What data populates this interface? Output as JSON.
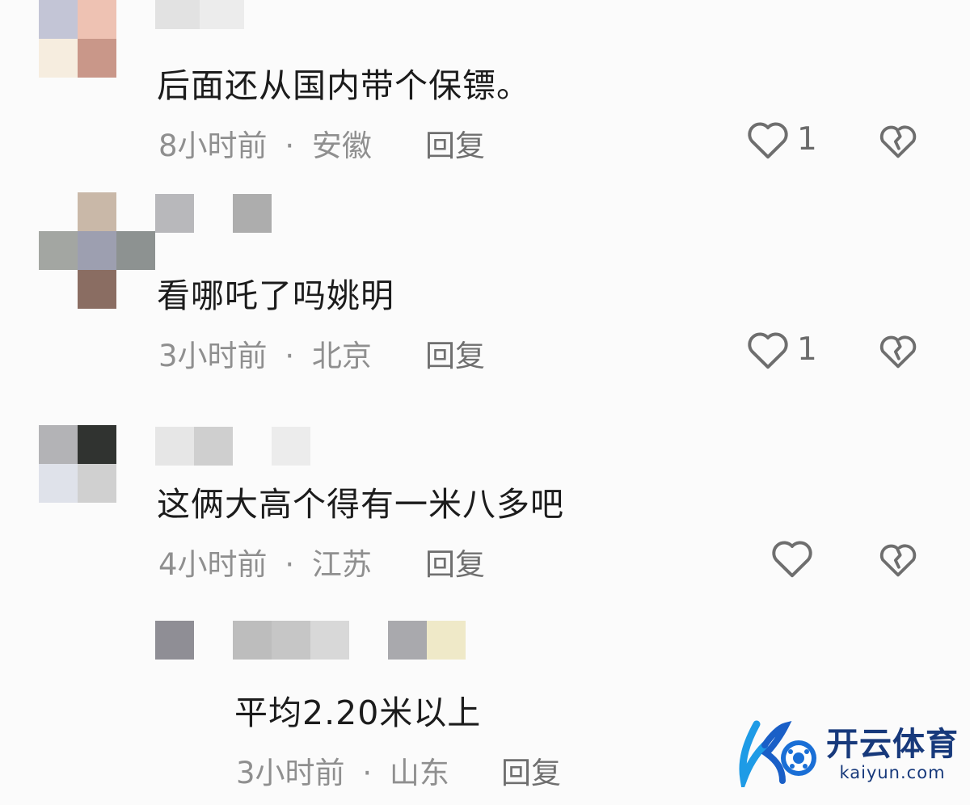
{
  "comments": [
    {
      "text": "后面还从国内带个保镖。",
      "time": "8小时前",
      "sep": "·",
      "location": "安徽",
      "reply_label": "回复",
      "likes": "1"
    },
    {
      "text": "看哪吒了吗姚明",
      "time": "3小时前",
      "sep": "·",
      "location": "北京",
      "reply_label": "回复",
      "likes": "1"
    },
    {
      "text": "这俩大高个得有一米八多吧",
      "time": "4小时前",
      "sep": "·",
      "location": "江苏",
      "reply_label": "回复",
      "likes": ""
    },
    {
      "text": "平均2.20米以上",
      "time": "3小时前",
      "sep": "·",
      "location": "山东",
      "reply_label": "回复"
    }
  ],
  "watermark": {
    "name": "开云体育",
    "domain": "kaiyun.com"
  },
  "icons": {
    "like": "heart-outline-icon",
    "dislike": "broken-heart-icon"
  },
  "colors": {
    "background": "#fbfbfb",
    "text": "#1c1c1c",
    "meta": "#8f8f8f",
    "watermark": "#17397b"
  }
}
